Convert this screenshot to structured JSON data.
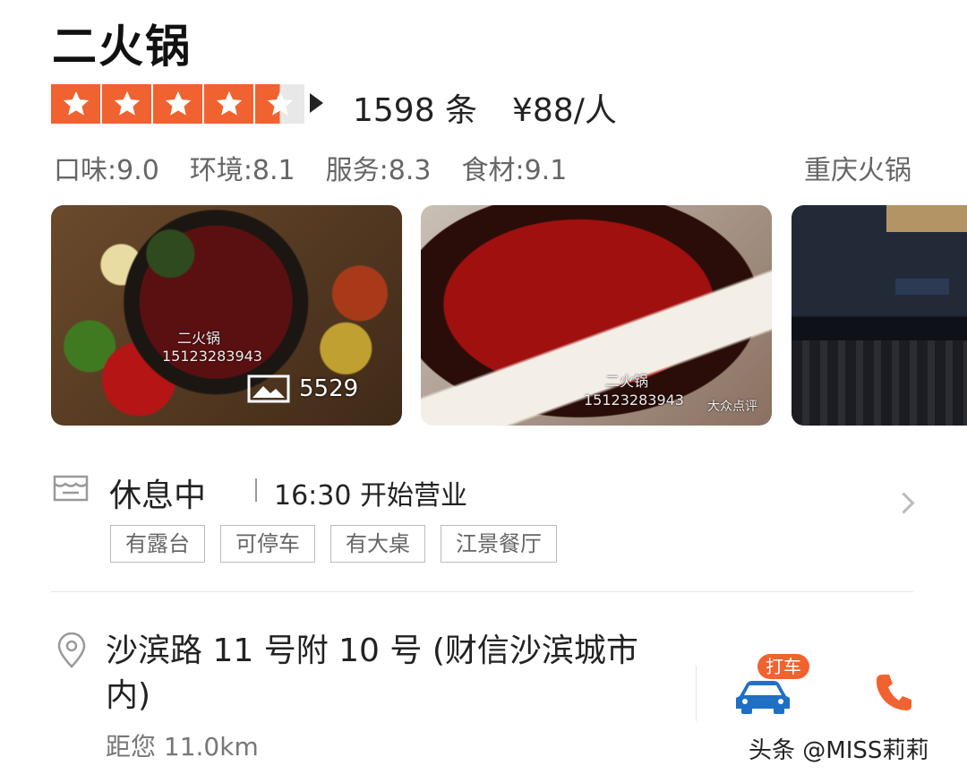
{
  "restaurant": {
    "name": "二火锅",
    "rating": {
      "stars": 4.5,
      "max": 5
    },
    "reviews": "1598 条",
    "price": "¥88/人",
    "scores": [
      {
        "label": "口味:9.0"
      },
      {
        "label": "环境:8.1"
      },
      {
        "label": "服务:8.3"
      },
      {
        "label": "食材:9.1"
      }
    ],
    "category": "重庆火锅"
  },
  "photos": {
    "count": "5529",
    "watermark_name": "二火锅",
    "watermark_phone": "15123283943",
    "watermark_brand": "大众点评"
  },
  "hours": {
    "status": "休息中",
    "open_time": "16:30 开始营业"
  },
  "tags": [
    "有露台",
    "可停车",
    "有大桌",
    "江景餐厅"
  ],
  "location": {
    "address": "沙滨路 11 号附 10 号 (财信沙滨城市内)",
    "distance": "距您 11.0km"
  },
  "actions": {
    "taxi_label": "打车"
  },
  "colors": {
    "accent": "#f0622f",
    "taxi_car": "#1f6fc5",
    "phone": "#f0622f"
  },
  "watermark": "头条 @MISS莉莉"
}
